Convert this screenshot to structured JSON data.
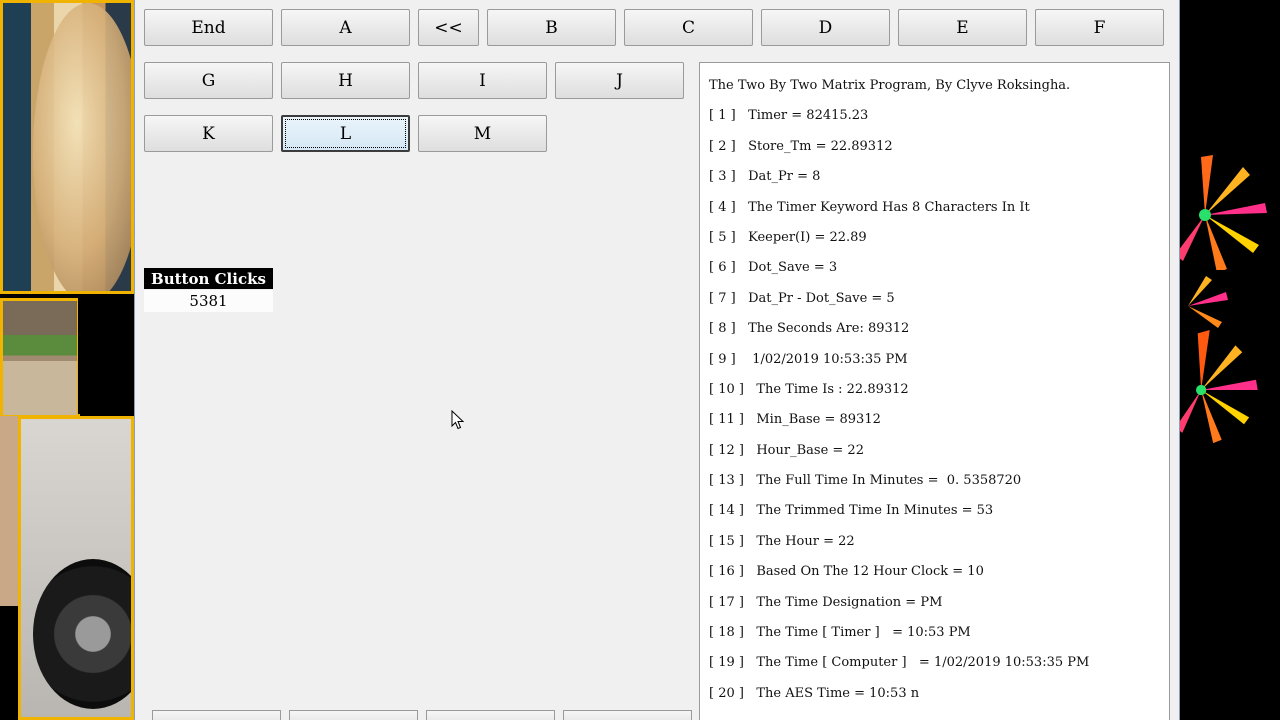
{
  "buttons": {
    "end": "End",
    "a": "A",
    "back": "<<",
    "b": "B",
    "c": "C",
    "d": "D",
    "e": "E",
    "f": "F",
    "g": "G",
    "h": "H",
    "i": "I",
    "j": "J",
    "k": "K",
    "l": "L",
    "m": "M"
  },
  "focused_button": "L",
  "button_clicks": {
    "label": "Button Clicks",
    "value": "5381"
  },
  "output": {
    "title": "The Two By Two Matrix Program, By Clyve Roksingha.",
    "lines": [
      "[ 1 ]   Timer = 82415.23",
      "[ 2 ]   Store_Tm = 22.89312",
      "[ 3 ]   Dat_Pr = 8",
      "[ 4 ]   The Timer Keyword Has 8 Characters In It",
      "[ 5 ]   Keeper(I) = 22.89",
      "[ 6 ]   Dot_Save = 3",
      "[ 7 ]   Dat_Pr - Dot_Save = 5",
      "[ 8 ]   The Seconds Are: 89312",
      "[ 9 ]    1/02/2019 10:53:35 PM",
      "[ 10 ]   The Time Is : 22.89312",
      "[ 11 ]   Min_Base = 89312",
      "[ 12 ]   Hour_Base = 22",
      "[ 13 ]   The Full Time In Minutes =  0. 5358720",
      "[ 14 ]   The Trimmed Time In Minutes = 53",
      "[ 15 ]   The Hour = 22",
      "[ 16 ]   Based On The 12 Hour Clock = 10",
      "[ 17 ]   The Time Designation = PM",
      "[ 18 ]   The Time [ Timer ]   = 10:53 PM",
      "[ 19 ]   The Time [ Computer ]   = 1/02/2019 10:53:35 PM",
      "[ 20 ]   The AES Time = 10:53 n"
    ]
  },
  "colors": {
    "window_bg": "#f0f0f0",
    "panel_bg": "#ffffff",
    "header_bg": "#000000",
    "frame_accent": "#f0b400"
  },
  "icons": [
    "mouse-pointer-icon"
  ]
}
